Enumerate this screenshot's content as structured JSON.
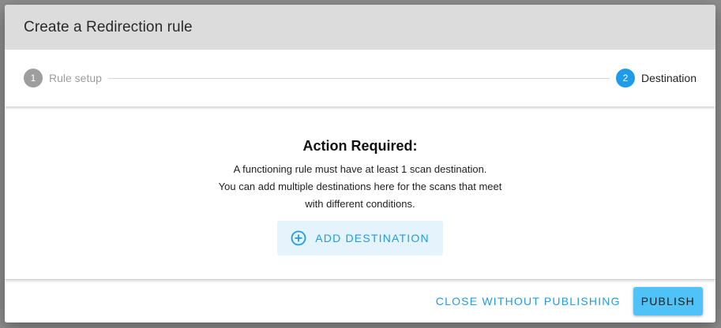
{
  "dialog": {
    "title": "Create a Redirection rule"
  },
  "stepper": {
    "steps": [
      {
        "number": "1",
        "label": "Rule setup",
        "state": "completed"
      },
      {
        "number": "2",
        "label": "Destination",
        "state": "active"
      }
    ]
  },
  "body": {
    "heading": "Action Required:",
    "lines": [
      "A functioning rule must have at least 1 scan destination.",
      "You can add multiple destinations here for the scans that meet",
      "with different conditions."
    ],
    "add_button_label": "ADD DESTINATION",
    "add_button_icon": "plus-circle-icon"
  },
  "footer": {
    "close_label": "CLOSE WITHOUT PUBLISHING",
    "publish_label": "PUBLISH"
  },
  "colors": {
    "accent": "#1e9be9",
    "publish_bg": "#4fc3f7",
    "header_bg": "#dcdcdc",
    "step_inactive": "#9e9e9e"
  }
}
